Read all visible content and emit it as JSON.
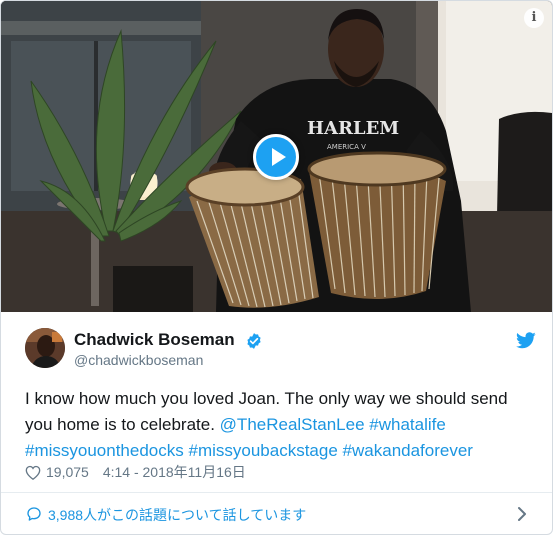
{
  "tweet": {
    "display_name": "Chadwick Boseman",
    "handle": "@chadwickboseman",
    "text_segments": [
      {
        "text": "I know how much you loved Joan. The only way we should send you home is to celebrate. ",
        "type": "text"
      },
      {
        "text": "@TheRealStanLee",
        "type": "mention"
      },
      {
        "text": " ",
        "type": "text"
      },
      {
        "text": "#whatalife",
        "type": "hashtag"
      },
      {
        "text": " ",
        "type": "text"
      },
      {
        "text": "#missyouonthedocks",
        "type": "hashtag"
      },
      {
        "text": " ",
        "type": "text"
      },
      {
        "text": "#missyoubackstage",
        "type": "hashtag"
      },
      {
        "text": " ",
        "type": "text"
      },
      {
        "text": "#wakandaforever",
        "type": "hashtag"
      }
    ],
    "likes": "19,075",
    "timestamp": "4:14 - 2018年11月16日",
    "conversation_label": "3,988人がこの話題について話しています"
  },
  "media": {
    "sweatshirt_text_1": "HARLEM",
    "sweatshirt_text_2": "AMERICA V",
    "info_label": "i"
  },
  "icons": {
    "verified": "verified-badge-icon",
    "bird": "twitter-bird-icon",
    "heart": "heart-icon",
    "chat": "chat-bubble-icon",
    "chevron": "chevron-right-icon",
    "play": "play-icon"
  },
  "colors": {
    "accent": "#1da1f2",
    "link": "#1b95e0",
    "secondary_text": "#657786",
    "primary_text": "#14171a"
  }
}
